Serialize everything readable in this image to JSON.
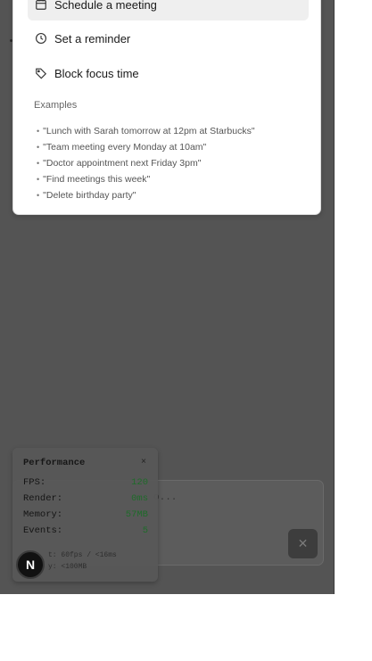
{
  "menu": {
    "items": [
      {
        "label": "Schedule a meeting",
        "icon": "calendar-icon",
        "active": true
      },
      {
        "label": "Set a reminder",
        "icon": "clock-icon",
        "active": false
      },
      {
        "label": "Block focus time",
        "icon": "tag-icon",
        "active": false
      }
    ],
    "examples_title": "Examples",
    "examples": [
      "\"Lunch with Sarah tomorrow at 12pm at Starbucks\"",
      "\"Team meeting every Monday at 10am\"",
      "\"Doctor appointment next Friday 3pm\"",
      "\"Find meetings this week\"",
      "\"Delete birthday party\""
    ]
  },
  "input": {
    "placeholder_fragment": "o..."
  },
  "send_button": {
    "icon": "close-icon",
    "glyph": "✕"
  },
  "performance": {
    "title": "Performance",
    "close_glyph": "×",
    "metrics": [
      {
        "label": "FPS:",
        "value": "120"
      },
      {
        "label": "Render:",
        "value": "0ms"
      },
      {
        "label": "Memory:",
        "value": "57MB"
      },
      {
        "label": "Events:",
        "value": "5"
      }
    ],
    "targets": [
      "t: 60fps / <16ms",
      "y: <100MB"
    ]
  },
  "badge": {
    "letter": "N"
  },
  "colors": {
    "overlay": "#545454",
    "metric_value": "#1f6b2a",
    "active_item_bg": "#efefef"
  }
}
